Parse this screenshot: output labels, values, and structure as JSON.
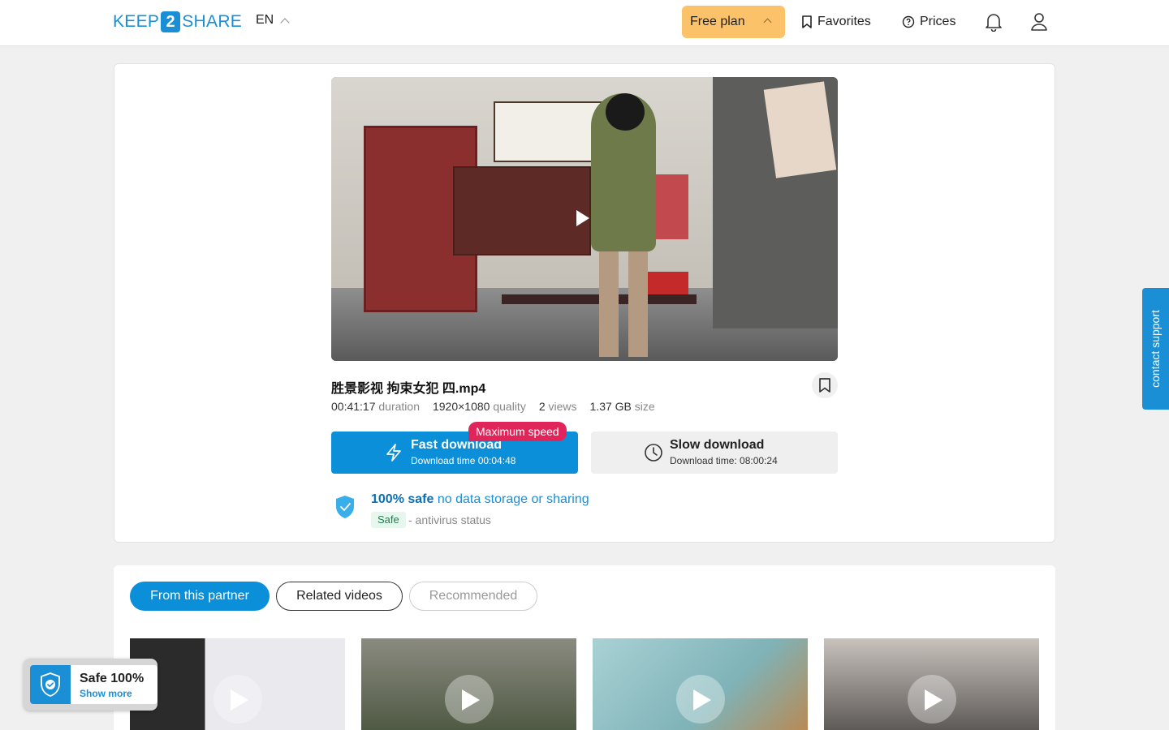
{
  "header": {
    "logo_left": "KEEP",
    "logo_mid": "2",
    "logo_right": "SHARE",
    "lang": "EN",
    "plan": "Free plan",
    "favorites": "Favorites",
    "prices": "Prices"
  },
  "file": {
    "name": "胜景影视 拘束女犯 四.mp4",
    "duration_val": "00:41:17",
    "duration_key": "duration",
    "quality_val": "1920×1080",
    "quality_key": "quality",
    "views_val": "2",
    "views_key": "views",
    "size_val": "1.37 GB",
    "size_key": "size"
  },
  "download": {
    "fast_label": "Fast download",
    "fast_time": "Download time 00:04:48",
    "max_badge": "Maximum speed",
    "slow_label": "Slow download",
    "slow_time": "Download time: 08:00:24"
  },
  "safety": {
    "bold": "100% safe",
    "text": "no data storage or sharing",
    "badge": "Safe",
    "status": "- antivirus status"
  },
  "tabs": [
    "From this partner",
    "Related videos",
    "Recommended"
  ],
  "widget": {
    "title": "Safe 100%",
    "link": "Show more"
  },
  "contact": "contact support",
  "colors": {
    "accent": "#0a8fd8",
    "plan": "#fcc26a",
    "badge": "#e0255a"
  }
}
